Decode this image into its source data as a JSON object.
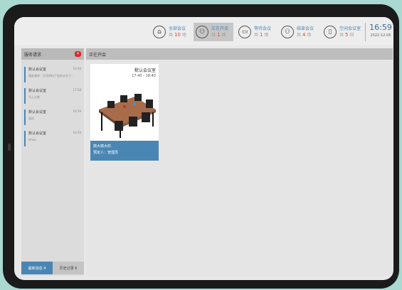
{
  "topbar": {
    "stats": [
      {
        "icon": "house-icon",
        "label": "全部会议",
        "count_prefix": "共",
        "count": "10",
        "unit": "场"
      },
      {
        "icon": "people-icon",
        "label": "正在开会",
        "count_prefix": "共",
        "count": "1",
        "unit": "场"
      },
      {
        "icon": "sofa-icon",
        "label": "等待会议",
        "count_prefix": "共",
        "count": "1",
        "unit": "场"
      },
      {
        "icon": "people-icon",
        "label": "结束会议",
        "count_prefix": "共",
        "count": "4",
        "unit": "场"
      },
      {
        "icon": "door-icon",
        "label": "空闲会议室",
        "count_prefix": "共",
        "count": "5",
        "unit": "间"
      }
    ],
    "time": "16:59",
    "date": "2022-12-06"
  },
  "service": {
    "title": "服务请求",
    "badge": "4",
    "messages": [
      {
        "title": "默认会议室",
        "time": "16:40",
        "preview": "服务请求：打印资料了加些水分了..."
      },
      {
        "title": "默认会议室",
        "time": "17:58",
        "preview": "马上过来"
      },
      {
        "title": "默认会议室",
        "time": "16:39",
        "preview": "清洁"
      },
      {
        "title": "默认会议室",
        "time": "16:39",
        "preview": "Ishao"
      }
    ],
    "tab_new": "最新消息 4",
    "tab_history": "历史记录 6"
  },
  "meeting": {
    "title": "正在开会",
    "card": {
      "room": "默认会议室",
      "time_range": "17:40 - 18:40",
      "subject": "搞大搞大的",
      "booker": "预定人：管理员"
    }
  },
  "colors": {
    "accent": "#4a86b4",
    "badge": "#d9282a",
    "count": "#e0452f"
  }
}
